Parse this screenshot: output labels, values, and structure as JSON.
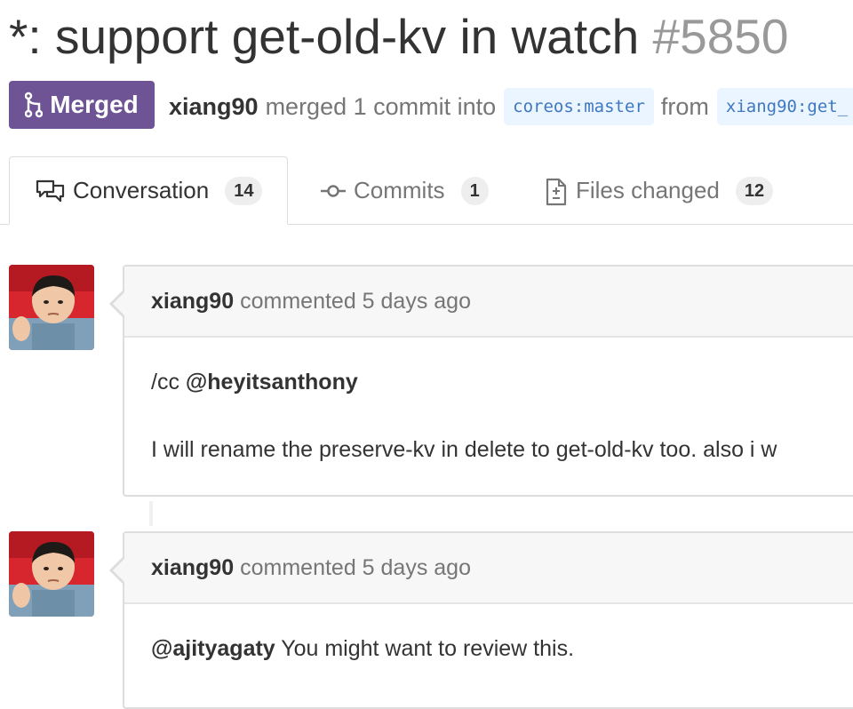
{
  "pull_request": {
    "title": "*: support get-old-kv in watch",
    "number": "#5850",
    "state": "Merged",
    "author": "xiang90",
    "merged_text": "merged 1 commit into",
    "base_branch": "coreos:master",
    "from_text": "from",
    "head_branch": "xiang90:get_"
  },
  "tabs": [
    {
      "label": "Conversation",
      "count": "14",
      "icon": "comment-discussion-icon",
      "selected": true
    },
    {
      "label": "Commits",
      "count": "1",
      "icon": "git-commit-icon",
      "selected": false
    },
    {
      "label": "Files changed",
      "count": "12",
      "icon": "file-diff-icon",
      "selected": false
    }
  ],
  "comments": [
    {
      "author": "xiang90",
      "action": "commented 5 days ago",
      "body": {
        "line1_prefix": "/cc ",
        "line1_mention": "@heyitsanthony",
        "line2": "I will rename the preserve-kv in delete to get-old-kv too. also i w"
      }
    },
    {
      "author": "xiang90",
      "action": "commented 5 days ago",
      "body": {
        "line1_mention": "@ajityagaty",
        "line1_rest": " You might want to review this."
      }
    }
  ],
  "colors": {
    "merged_badge": "#6e5494",
    "branch_bg": "#eaf5ff",
    "branch_text": "#4078c0",
    "muted_text": "#767676",
    "number_text": "#999999"
  }
}
